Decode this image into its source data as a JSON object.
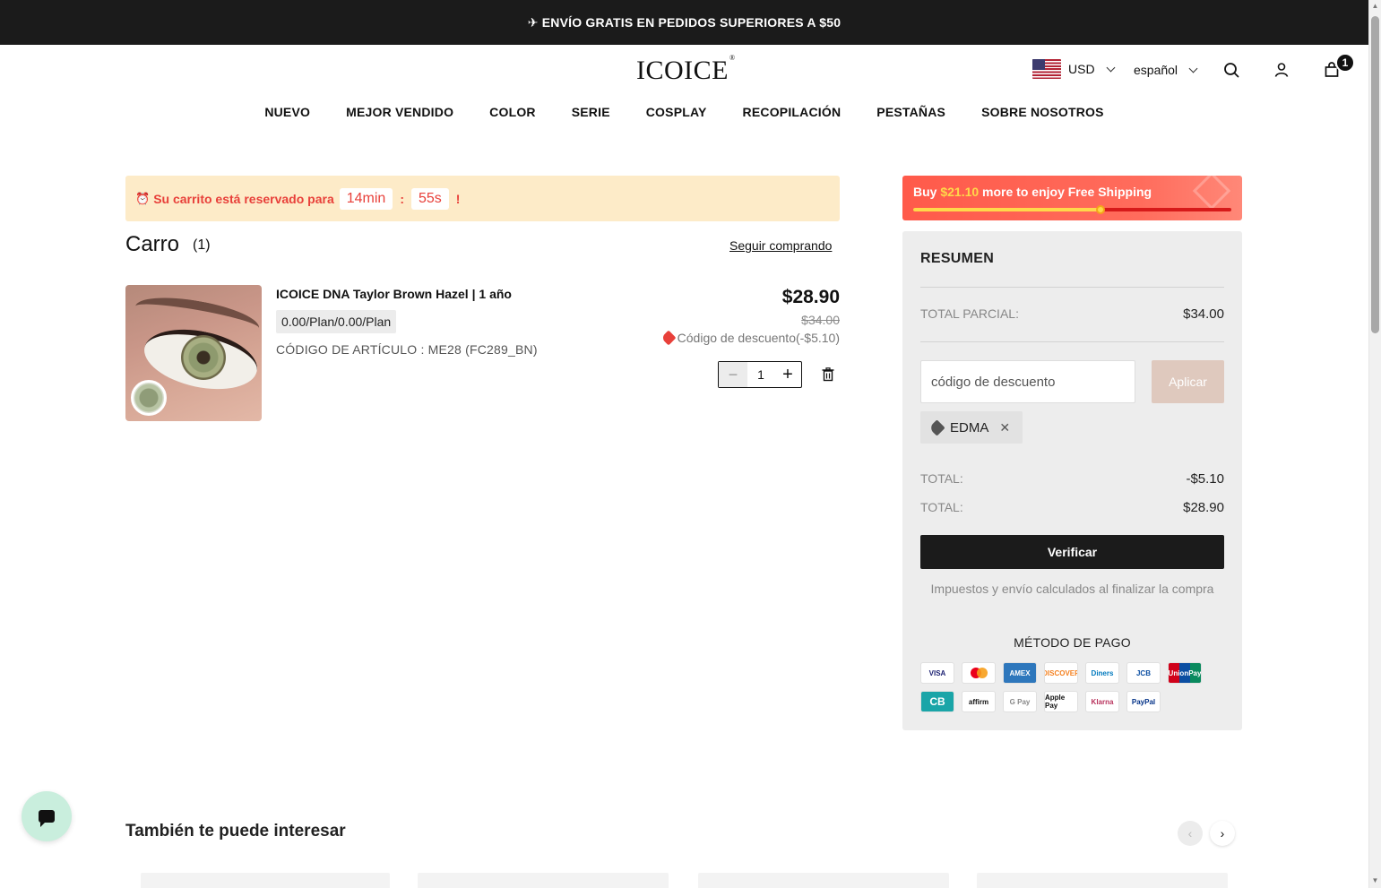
{
  "announcement": {
    "icon": "airplane-icon",
    "text": "ENVÍO GRATIS EN PEDIDOS SUPERIORES A $50"
  },
  "header": {
    "logo": "ICOICE",
    "logo_mark": "®",
    "currency": "USD",
    "language": "español",
    "cart_count": "1"
  },
  "nav": {
    "items": [
      "NUEVO",
      "MEJOR VENDIDO",
      "COLOR",
      "SERIE",
      "COSPLAY",
      "RECOPILACIÓN",
      "PESTAÑAS",
      "SOBRE NOSOTROS"
    ]
  },
  "timer": {
    "prefix": "Su carrito está reservado para",
    "minutes": "14min",
    "separator": ":",
    "seconds": "55s",
    "suffix": "!"
  },
  "cart": {
    "title": "Carro",
    "count": "(1)",
    "continue_link": "Seguir comprando",
    "item": {
      "name": "ICOICE DNA Taylor Brown Hazel | 1 año",
      "variant": "0.00/Plan/0.00/Plan",
      "sku": "CÓDIGO DE ARTÍCULO : ME28 (FC289_BN)",
      "price": "$28.90",
      "old_price": "$34.00",
      "discount": "Código de descuento(-$5.10)",
      "quantity": "1"
    }
  },
  "shipping": {
    "pre": "Buy ",
    "amount": "$21.10",
    "post": " more to enjoy Free Shipping",
    "progress": 0.59
  },
  "summary": {
    "title": "RESUMEN",
    "subtotal_label": "TOTAL PARCIAL:",
    "subtotal_value": "$34.00",
    "code_placeholder": "código de descuento",
    "apply_label": "Aplicar",
    "applied_code": "EDMA",
    "discount_label": "TOTAL:",
    "discount_value": "-$5.10",
    "total_label": "TOTAL:",
    "total_value": "$28.90",
    "checkout_label": "Verificar",
    "tax_note": "Impuestos y envío calculados al finalizar la compra",
    "payment_title": "MÉTODO DE PAGO",
    "payment_methods": [
      {
        "name": "VISA",
        "color": "#1a1f71"
      },
      {
        "name": "Mastercard",
        "color": "#eb001b"
      },
      {
        "name": "AMEX",
        "color": "#2e77bc"
      },
      {
        "name": "DISCOVER",
        "color": "#f48120"
      },
      {
        "name": "Diners",
        "color": "#0079be"
      },
      {
        "name": "JCB",
        "color": "#0b4ea2"
      },
      {
        "name": "UnionPay",
        "color": "#d0021b"
      },
      {
        "name": "CB",
        "color": "#1aa5a8"
      },
      {
        "name": "affirm",
        "color": "#111111"
      },
      {
        "name": "G Pay",
        "color": "#888888"
      },
      {
        "name": "Apple Pay",
        "color": "#111111"
      },
      {
        "name": "Klarna",
        "color": "#ffb3c7"
      },
      {
        "name": "PayPal",
        "color": "#003087"
      }
    ]
  },
  "recommendations": {
    "title": "También te puede interesar"
  }
}
